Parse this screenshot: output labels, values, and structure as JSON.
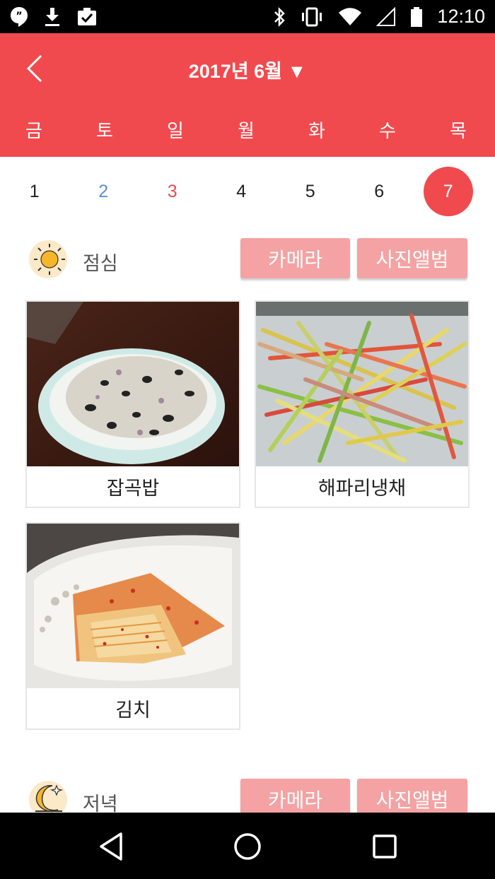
{
  "status_bar": {
    "time": "12:10",
    "icons_left": [
      "hangouts-icon",
      "download-icon",
      "clipboard-check-icon"
    ],
    "icons_right": [
      "bluetooth-icon",
      "vibrate-icon",
      "wifi-icon",
      "signal-icon",
      "battery-icon"
    ]
  },
  "header": {
    "month_title": "2017년 6월 ▼",
    "back_icon": "chevron-left-icon",
    "accent_color": "#f14a4e",
    "weekdays": [
      "금",
      "토",
      "일",
      "월",
      "화",
      "수",
      "목"
    ]
  },
  "dates": [
    "1",
    "2",
    "3",
    "4",
    "5",
    "6",
    "7"
  ],
  "selected_date": "7",
  "meals": [
    {
      "label": "점심",
      "icon": "sun-icon",
      "camera_label": "카메라",
      "album_label": "사진앨범",
      "foods": [
        {
          "name": "잡곡밥",
          "photo": "mixed-grain-rice-photo"
        },
        {
          "name": "해파리냉채",
          "photo": "jellyfish-salad-photo"
        },
        {
          "name": "김치",
          "photo": "kimchi-photo"
        }
      ]
    },
    {
      "label": "저녁",
      "icon": "moon-icon",
      "camera_label": "카메라",
      "album_label": "사진앨범"
    }
  ],
  "nav_bar": {
    "buttons": [
      "back-triangle-icon",
      "home-circle-icon",
      "recents-square-icon"
    ]
  }
}
